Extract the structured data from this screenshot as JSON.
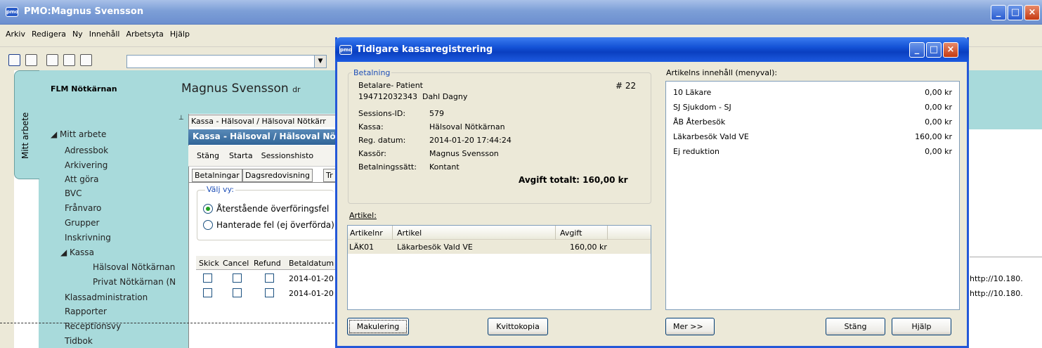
{
  "main": {
    "title": "PMO:Magnus Svensson",
    "app_icon": "pmo",
    "menu": [
      "Arkiv",
      "Redigera",
      "Ny",
      "Innehåll",
      "Arbetsyta",
      "Hjälp"
    ],
    "vertical_tab": "Mitt arbete",
    "clinic": "FLM Nötkärnan",
    "user": "Magnus Svensson",
    "user_suffix": "dr",
    "nav": {
      "root": "Mitt arbete",
      "items": [
        "Adressbok",
        "Arkivering",
        "Att göra",
        "BVC",
        "Frånvaro",
        "Grupper",
        "Inskrivning"
      ],
      "kassa": "Kassa",
      "kassa_children": [
        "Hälsoval Nötkärnan",
        "Privat Nötkärnan (N"
      ],
      "items_after": [
        "Klassadministration",
        "Rapporter",
        "Receptionsvy",
        "Tidbok"
      ]
    },
    "url_snippets": [
      "http://10.180.",
      "http://10.180."
    ]
  },
  "kassa": {
    "tab_title": "Kassa - Hälsoval / Hälsoval Nötkärr",
    "header": "Kassa - Hälsoval / Hälsoval Nö",
    "toolbar": [
      "Stäng",
      "Starta",
      "Sessionshisto"
    ],
    "tabs": [
      "Betalningar",
      "Dagsredovisning",
      "Tr"
    ],
    "view_label": "Välj vy:",
    "radio_1": "Återstående överföringsfel",
    "radio_2": "Hanterade fel (ej överförda)",
    "grid_headers": [
      "Skick",
      "Cancel",
      "Refund",
      "Betaldatum"
    ],
    "rows": [
      {
        "date": "2014-01-20"
      },
      {
        "date": "2014-01-20"
      }
    ]
  },
  "dialog": {
    "title": "Tidigare kassaregistrering",
    "payment": {
      "legend": "Betalning",
      "payer_label": "Betalare- Patient",
      "number": "# 22",
      "patient": "194712032343  Dahl Dagny",
      "fields": [
        {
          "label": "Sessions-ID:",
          "value": "579"
        },
        {
          "label": "Kassa:",
          "value": "Hälsoval Nötkärnan"
        },
        {
          "label": "Reg. datum:",
          "value": "2014-01-20 17:44:24"
        },
        {
          "label": "Kassör:",
          "value": "Magnus Svensson"
        },
        {
          "label": "Betalningssätt:",
          "value": "Kontant"
        }
      ],
      "total": "Avgift totalt: 160,00 kr"
    },
    "article": {
      "label": "Artikel:",
      "headers": [
        "Artikelnr",
        "Artikel",
        "Avgift"
      ],
      "rows": [
        {
          "nr": "LÄK01",
          "name": "Läkarbesök Vald VE",
          "fee": "160,00 kr"
        }
      ]
    },
    "contents": {
      "label": "Artikelns innehåll (menyval):",
      "rows": [
        {
          "name": "10 Läkare",
          "amount": "0,00 kr"
        },
        {
          "name": "SJ Sjukdom - SJ",
          "amount": "0,00 kr"
        },
        {
          "name": "ÅB Återbesök",
          "amount": "0,00 kr"
        },
        {
          "name": "Läkarbesök Vald VE",
          "amount": "160,00 kr"
        },
        {
          "name": "Ej reduktion",
          "amount": "0,00 kr"
        }
      ]
    },
    "buttons": {
      "makulering": "Makulering",
      "kvittokopia": "Kvittokopia",
      "mer": "Mer >>",
      "stang": "Stäng",
      "hjalp": "Hjälp"
    }
  }
}
